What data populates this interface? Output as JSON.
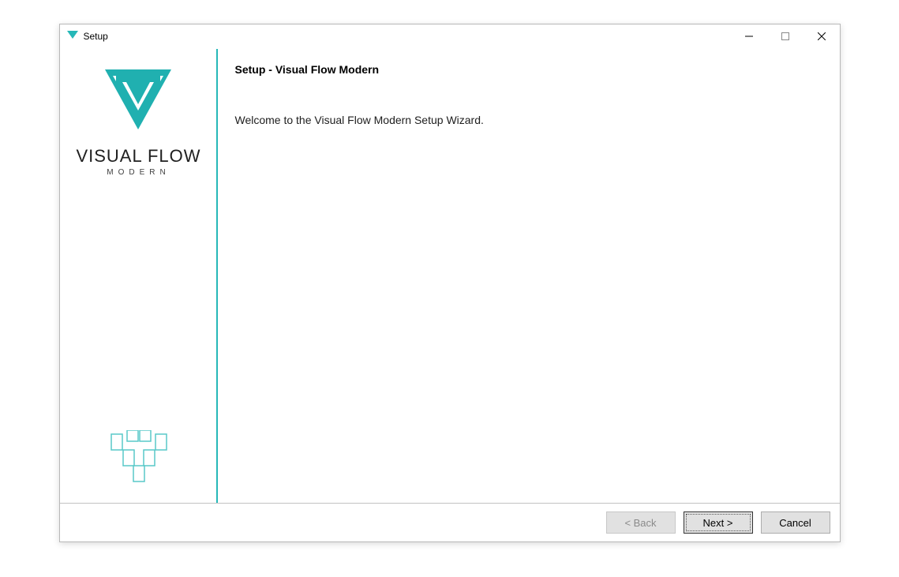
{
  "window": {
    "title": "Setup"
  },
  "brand": {
    "name": "VISUAL FLOW",
    "sub": "MODERN"
  },
  "main": {
    "heading": "Setup - Visual Flow Modern",
    "body": "Welcome to the Visual Flow Modern Setup Wizard."
  },
  "footer": {
    "back": "< Back",
    "next": "Next >",
    "cancel": "Cancel"
  },
  "colors": {
    "accent": "#26b8b8"
  }
}
